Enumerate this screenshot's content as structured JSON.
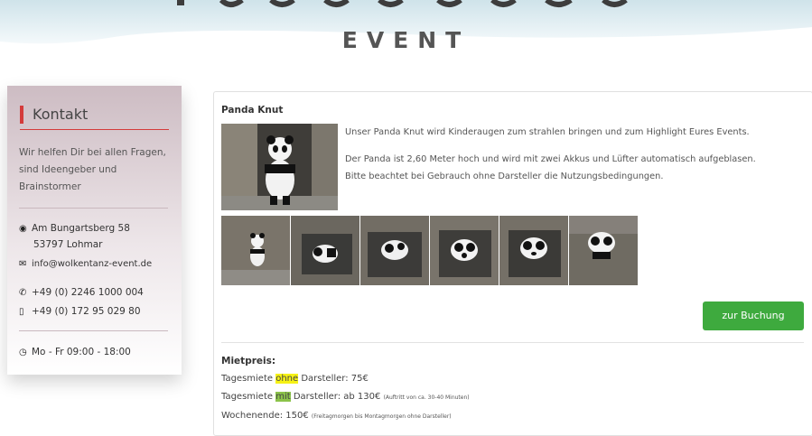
{
  "header": {
    "logo_word": "EVENT"
  },
  "sidebar": {
    "title": "Kontakt",
    "intro": "Wir helfen Dir bei allen Fragen, sind Ideengeber und Brainstormer",
    "address_line1": "Am Bungartsberg 58",
    "address_line2": "53797 Lohmar",
    "email": "info@wolkentanz-event.de",
    "phone": "+49 (0) 2246 1000 004",
    "mobile": "+49 (0) 172 95 029 80",
    "hours": "Mo - Fr 09:00 - 18:00"
  },
  "product": {
    "title": "Panda Knut",
    "desc1": "Unser Panda Knut wird Kinderaugen zum strahlen bringen und zum Highlight Eures Events.",
    "desc2": "Der Panda ist 2,60 Meter hoch und wird mit zwei Akkus und Lüfter automatisch aufgeblasen.",
    "desc3": "Bitte beachtet bei Gebrauch ohne Darsteller die Nutzungsbedingungen.",
    "book_button": "zur Buchung",
    "thumbnail_count": 6
  },
  "pricing": {
    "title": "Mietpreis:",
    "l1_pre": "Tagesmiete ",
    "l1_hl": "ohne",
    "l1_post": " Darsteller: 75€",
    "l2_pre": "Tagesmiete ",
    "l2_hl": "mit",
    "l2_post": " Darsteller: ab 130€ ",
    "l2_note": "(Auftritt von ca. 30-40 Minuten)",
    "l3_main": "Wochenende: 150€ ",
    "l3_note": "(Freitagmorgen bis Montagmorgen ohne Darsteller)"
  },
  "colors": {
    "accent_red": "#d43b3b",
    "button_green": "#3eaa3e",
    "highlight_yellow": "#f6f215",
    "highlight_green": "#8bc34a"
  }
}
